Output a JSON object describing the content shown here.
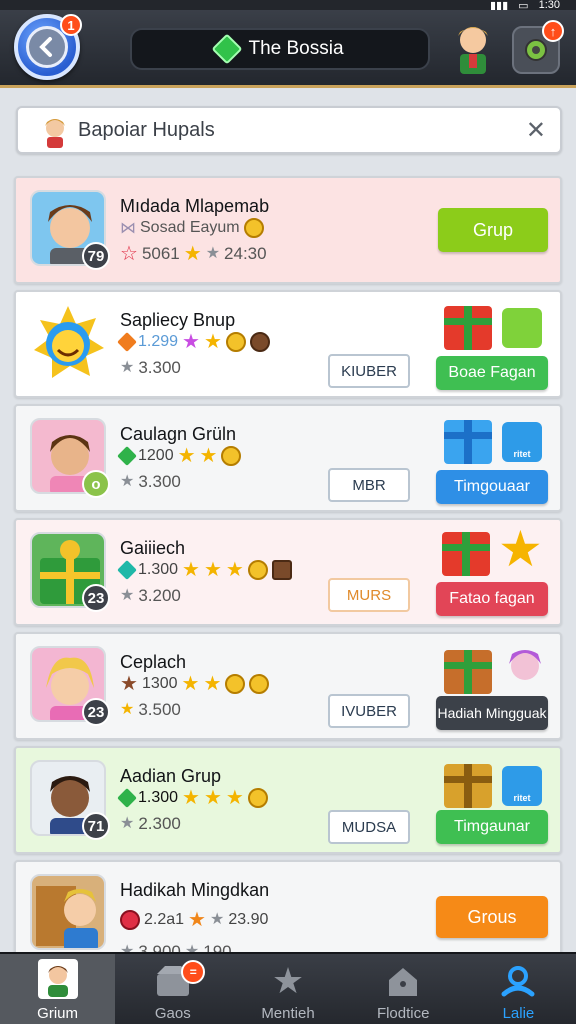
{
  "status": {
    "icons": [
      "signal-icon",
      "wifi-icon",
      "battery-icon"
    ],
    "time": "1:30"
  },
  "header": {
    "back_badge": "1",
    "title": "The Bossia",
    "gear_badge": "↑"
  },
  "search": {
    "value": "Bapoiar Hupals"
  },
  "rows": [
    {
      "name": "Mıdada Mlapemab",
      "line2": "Sosad Eayum",
      "score": "5061",
      "time": "24:30",
      "level": "79",
      "button": "Grup"
    },
    {
      "name": "Sapliecy Bnup",
      "score": "1.299",
      "sub": "3.300",
      "outline": "KIUBER",
      "button": "Boae Fagan"
    },
    {
      "name": "Caulagn Grüln",
      "score": "1200",
      "sub": "3.300",
      "outline": "MBR",
      "button": "Timgouaar",
      "tile_text": "ritet"
    },
    {
      "name": "Gaiiiech",
      "score": "1.300",
      "sub": "3.200",
      "level": "23",
      "outline": "MURS",
      "button": "Fataо fagan"
    },
    {
      "name": "Ceplach",
      "score": "1300",
      "sub": "3.500",
      "level": "23",
      "outline": "IVUBER",
      "button": "Hadiah Mingguak"
    },
    {
      "name": "Aadian Grup",
      "score": "1.300",
      "sub": "2.300",
      "level": "71",
      "outline": "MUDSA",
      "button": "Timgaunar",
      "tile_text": "ritet"
    },
    {
      "name": "Hadikah Mingdkan",
      "score": "2.2a1",
      "time": "23.90",
      "sub": "3.900",
      "sub2": "190",
      "button": "Grous"
    }
  ],
  "nav": [
    {
      "label": "Grium"
    },
    {
      "label": "Gaos",
      "badge": "="
    },
    {
      "label": "Mentieh"
    },
    {
      "label": "Flodtice"
    },
    {
      "label": "Lalie"
    }
  ],
  "colors": {
    "green_btn": "#3fbf52",
    "blue_btn": "#2e8fe6",
    "red_btn": "#e24557",
    "orange_btn": "#f68a17",
    "lime_btn": "#8ccc1a",
    "dark_btn": "#3c4149"
  }
}
